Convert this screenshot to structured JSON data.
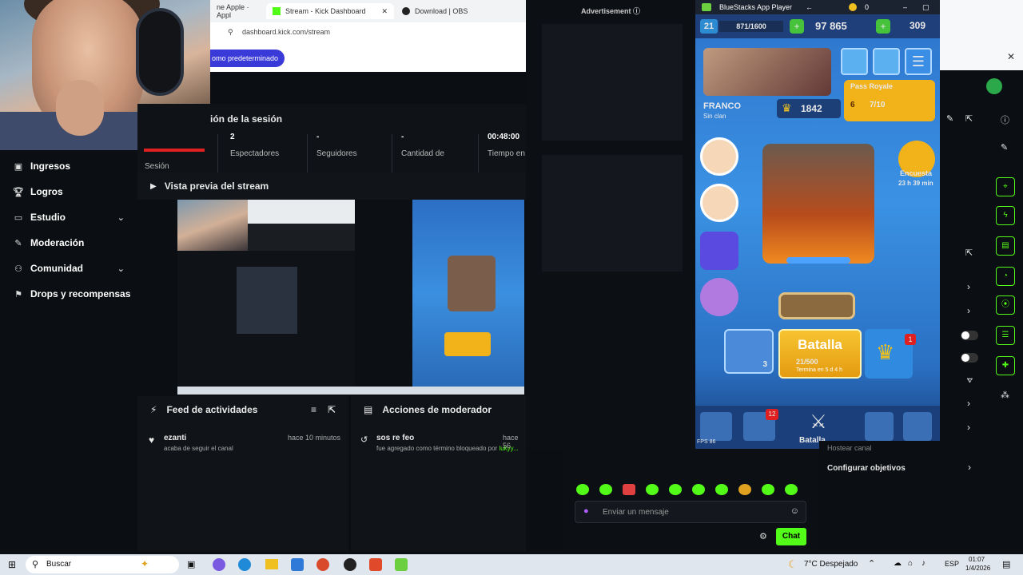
{
  "browser": {
    "tabs": [
      "ne Apple · Appl",
      "Stream - Kick Dashboard",
      "Download | OBS"
    ],
    "url": "dashboard.kick.com/stream",
    "default_button": "omo predeterminado"
  },
  "sidebar": {
    "items": [
      {
        "label": "Ingresos",
        "icon": "wallet-icon",
        "chevron": false
      },
      {
        "label": "Logros",
        "icon": "trophy-icon",
        "chevron": false
      },
      {
        "label": "Estudio",
        "icon": "studio-icon",
        "chevron": true
      },
      {
        "label": "Moderación",
        "icon": "wrench-icon",
        "chevron": false
      },
      {
        "label": "Comunidad",
        "icon": "people-icon",
        "chevron": true
      },
      {
        "label": "Drops y recompensas",
        "icon": "gift-icon",
        "chevron": false
      }
    ]
  },
  "session": {
    "title": "ión de la sesión",
    "session_label": "Sesión",
    "stats": [
      {
        "value": "2",
        "label": "Espectadores"
      },
      {
        "value": "-",
        "label": "Seguidores"
      },
      {
        "value": "-",
        "label": "Cantidad de"
      },
      {
        "value": "00:48:00",
        "label": "Tiempo en"
      }
    ]
  },
  "preview": {
    "title": "Vista previa del stream"
  },
  "feed": {
    "title": "Feed de actividades",
    "entries": [
      {
        "user": "ezanti",
        "action": "acaba de seguir el canal",
        "time": "hace 10 minutos"
      }
    ]
  },
  "mod": {
    "title": "Acciones de moderador",
    "entries": [
      {
        "term": "sos re feo",
        "action": "fue agregado como término bloqueado por",
        "by": "lukyy...",
        "time": "hace 56"
      }
    ]
  },
  "ad": {
    "label": "Advertisement ⓘ"
  },
  "game": {
    "window_title": "BlueStacks App Player",
    "level": "21",
    "xp": "871/1600",
    "gold": "97 865",
    "gems": "309",
    "player_name": "FRANCO",
    "clan": "Sin clan",
    "trophies": "1842",
    "pass_label": "Pass Royale",
    "pass_level": "6",
    "pass_progress": "7/10",
    "survey_label": "Encuesta",
    "survey_time": "23 h 39 min",
    "battle_label": "Batalla",
    "battle_progress": "21/500",
    "battle_sub": "Termina en 5 d 4 h",
    "deck_count": "3",
    "notif_count": "1",
    "shop_badge": "12",
    "nav_label": "Batalla",
    "fps_label": "FPS",
    "fps_value": "86",
    "coin_top": "0"
  },
  "chat": {
    "placeholder": "Enviar un mensaje",
    "send": "Chat",
    "host_label": "Hostear canal",
    "goals_label": "Configurar objetivos"
  },
  "taskbar": {
    "search": "Buscar",
    "weather": "7°C Despejado",
    "lang": "ESP",
    "time": "01:07",
    "date": "1/4/2026"
  }
}
